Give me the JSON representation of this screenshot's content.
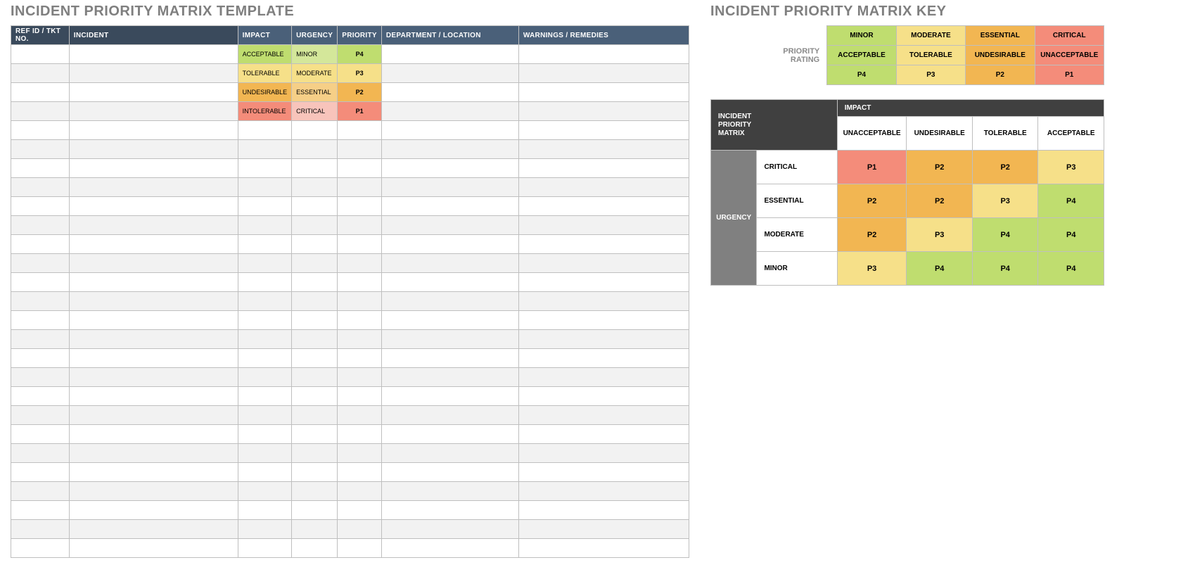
{
  "left": {
    "title": "INCIDENT PRIORITY MATRIX TEMPLATE",
    "headers": {
      "ref": "REF ID / TKT NO.",
      "incident": "INCIDENT",
      "impact": "IMPACT",
      "urgency": "URGENCY",
      "priority": "PRIORITY",
      "dept": "DEPARTMENT / LOCATION",
      "warn": "WARNINGS / REMEDIES"
    },
    "rows": [
      {
        "impact": "ACCEPTABLE",
        "urgency": "MINOR",
        "priority": "P4",
        "impact_cls": "green",
        "urgency_cls": "green-l",
        "priority_cls": "green"
      },
      {
        "impact": "TOLERABLE",
        "urgency": "MODERATE",
        "priority": "P3",
        "impact_cls": "yellow",
        "urgency_cls": "yellow",
        "priority_cls": "yellow"
      },
      {
        "impact": "UNDESIRABLE",
        "urgency": "ESSENTIAL",
        "priority": "P2",
        "impact_cls": "orange",
        "urgency_cls": "orange-l",
        "priority_cls": "orange"
      },
      {
        "impact": "INTOLERABLE",
        "urgency": "CRITICAL",
        "priority": "P1",
        "impact_cls": "red",
        "urgency_cls": "red-l",
        "priority_cls": "red"
      }
    ],
    "empty_rows": 23
  },
  "right": {
    "title": "INCIDENT PRIORITY MATRIX KEY",
    "key": {
      "label1": "PRIORITY",
      "label2": "RATING",
      "cols": [
        {
          "name": "MINOR",
          "impact": "ACCEPTABLE",
          "p": "P4",
          "cls": "green"
        },
        {
          "name": "MODERATE",
          "impact": "TOLERABLE",
          "p": "P3",
          "cls": "yellow"
        },
        {
          "name": "ESSENTIAL",
          "impact": "UNDESIRABLE",
          "p": "P2",
          "cls": "orange"
        },
        {
          "name": "CRITICAL",
          "impact": "UNACCEPTABLE",
          "p": "P1",
          "cls": "red"
        }
      ]
    },
    "matrix": {
      "corner": "INCIDENT\nPRIORITY\nMATRIX",
      "impact_label": "IMPACT",
      "urgency_label": "URGENCY",
      "cols": [
        "UNACCEPTABLE",
        "UNDESIRABLE",
        "TOLERABLE",
        "ACCEPTABLE"
      ],
      "rows": [
        {
          "name": "CRITICAL",
          "cells": [
            {
              "p": "P1",
              "cls": "red"
            },
            {
              "p": "P2",
              "cls": "orange"
            },
            {
              "p": "P2",
              "cls": "orange"
            },
            {
              "p": "P3",
              "cls": "yellow"
            }
          ]
        },
        {
          "name": "ESSENTIAL",
          "cells": [
            {
              "p": "P2",
              "cls": "orange"
            },
            {
              "p": "P2",
              "cls": "orange"
            },
            {
              "p": "P3",
              "cls": "yellow"
            },
            {
              "p": "P4",
              "cls": "green"
            }
          ]
        },
        {
          "name": "MODERATE",
          "cells": [
            {
              "p": "P2",
              "cls": "orange"
            },
            {
              "p": "P3",
              "cls": "yellow"
            },
            {
              "p": "P4",
              "cls": "green"
            },
            {
              "p": "P4",
              "cls": "green"
            }
          ]
        },
        {
          "name": "MINOR",
          "cells": [
            {
              "p": "P3",
              "cls": "yellow"
            },
            {
              "p": "P4",
              "cls": "green"
            },
            {
              "p": "P4",
              "cls": "green"
            },
            {
              "p": "P4",
              "cls": "green"
            }
          ]
        }
      ]
    }
  }
}
